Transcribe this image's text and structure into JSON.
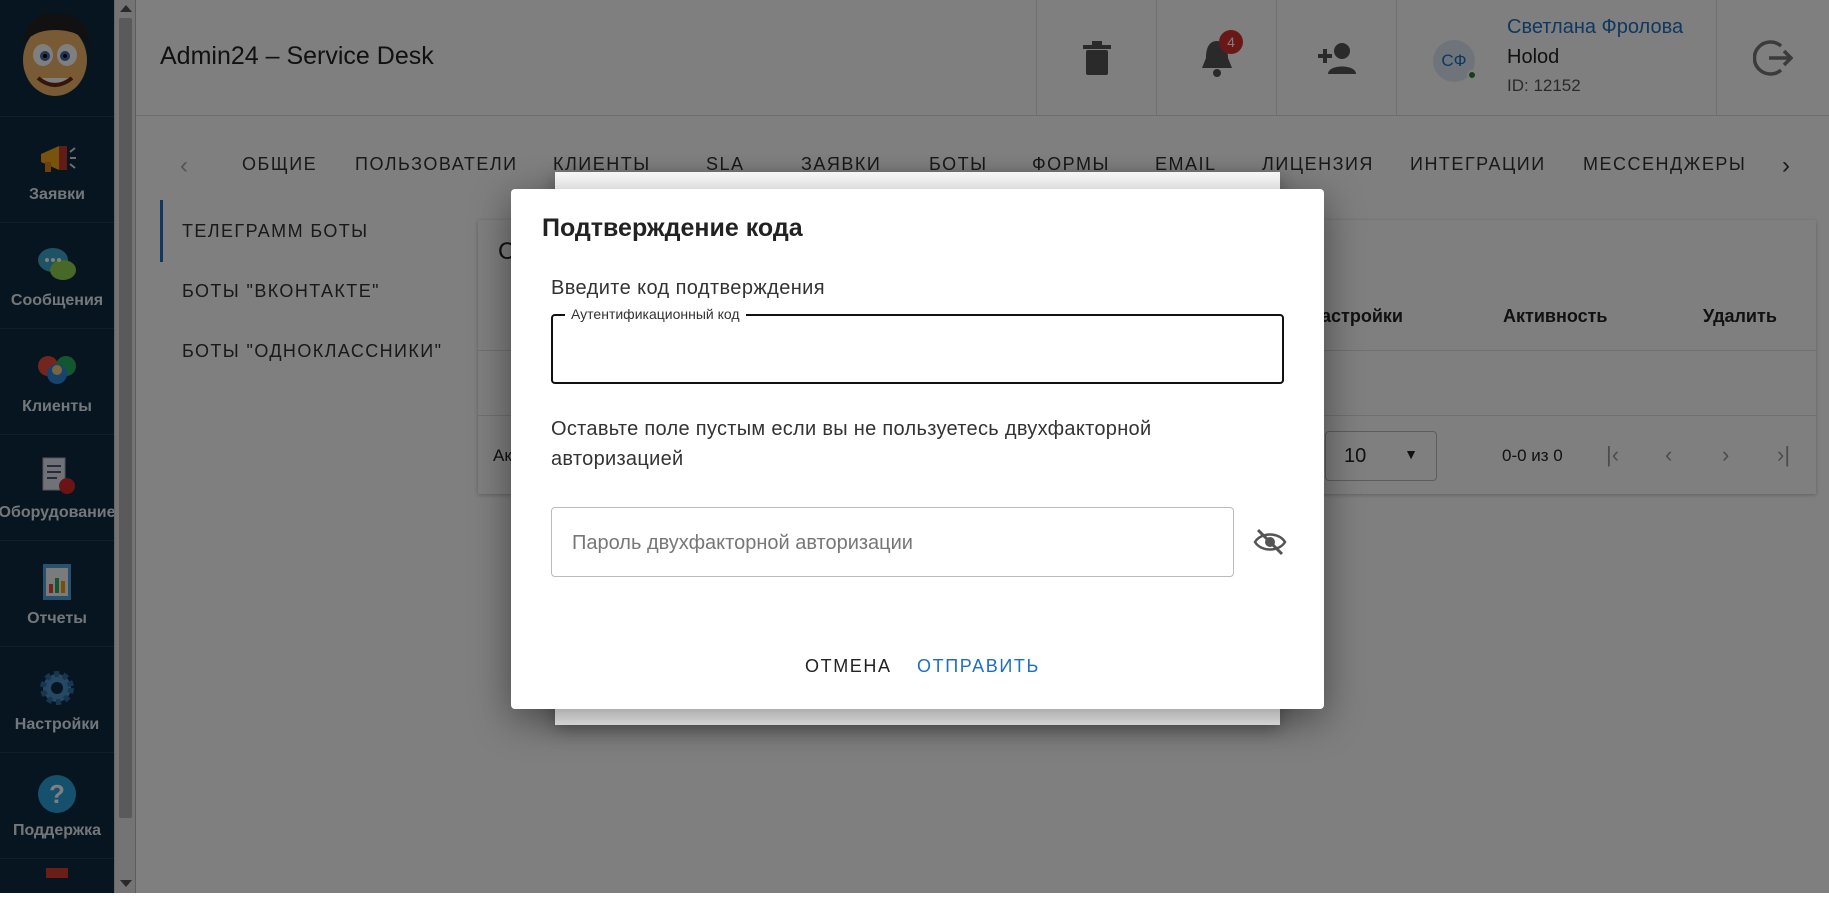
{
  "app": {
    "title": "Admin24 – Service Desk"
  },
  "sidebar": {
    "items": [
      {
        "label": "Заявки",
        "icon": "megaphone-icon"
      },
      {
        "label": "Сообщения",
        "icon": "chat-bubbles-icon"
      },
      {
        "label": "Клиенты",
        "icon": "clients-icon"
      },
      {
        "label": "Оборудование",
        "icon": "equipment-icon"
      },
      {
        "label": "Отчеты",
        "icon": "reports-icon"
      },
      {
        "label": "Настройки",
        "icon": "gear-icon"
      },
      {
        "label": "Поддержка",
        "icon": "help-icon"
      }
    ]
  },
  "header": {
    "notifications_count": "4",
    "user": {
      "initials": "СФ",
      "name": "Светлана Фролова",
      "org": "Holod",
      "id": "ID: 12152"
    }
  },
  "tabs": [
    "ОБЩИЕ",
    "ПОЛЬЗОВАТЕЛИ",
    "КЛИЕНТЫ",
    "SLA",
    "ЗАЯВКИ",
    "БОТЫ",
    "ФОРМЫ",
    "EMAIL",
    "ЛИЦЕНЗИЯ",
    "ИНТЕГРАЦИИ",
    "МЕССЕНДЖЕРЫ"
  ],
  "subnav": [
    "ТЕЛЕГРАММ БОТЫ",
    "БОТЫ \"ВКОНТАКТЕ\"",
    "БОТЫ \"ОДНОКЛАССНИКИ\""
  ],
  "table": {
    "title_fragment": "С",
    "columns": [
      "Настройки",
      "Активность",
      "Удалить"
    ],
    "footer_fragment": "Ак",
    "rows_per_page": "10",
    "page_info": "0-0 из 0"
  },
  "dialog": {
    "title": "Подтверждение кода",
    "prompt": "Введите код подтверждения",
    "code_field_label": "Аутентификационный код",
    "code_value": "",
    "hint": "Оставьте поле пустым если вы не пользуетесь двухфакторной авторизацией",
    "password_placeholder": "Пароль двухфакторной авторизации",
    "cancel_label": "ОТМЕНА",
    "submit_label": "ОТПРАВИТЬ"
  },
  "colors": {
    "accent": "#1e6fbf",
    "sidebar": "#0c2a40",
    "badge": "#d32f2f"
  }
}
